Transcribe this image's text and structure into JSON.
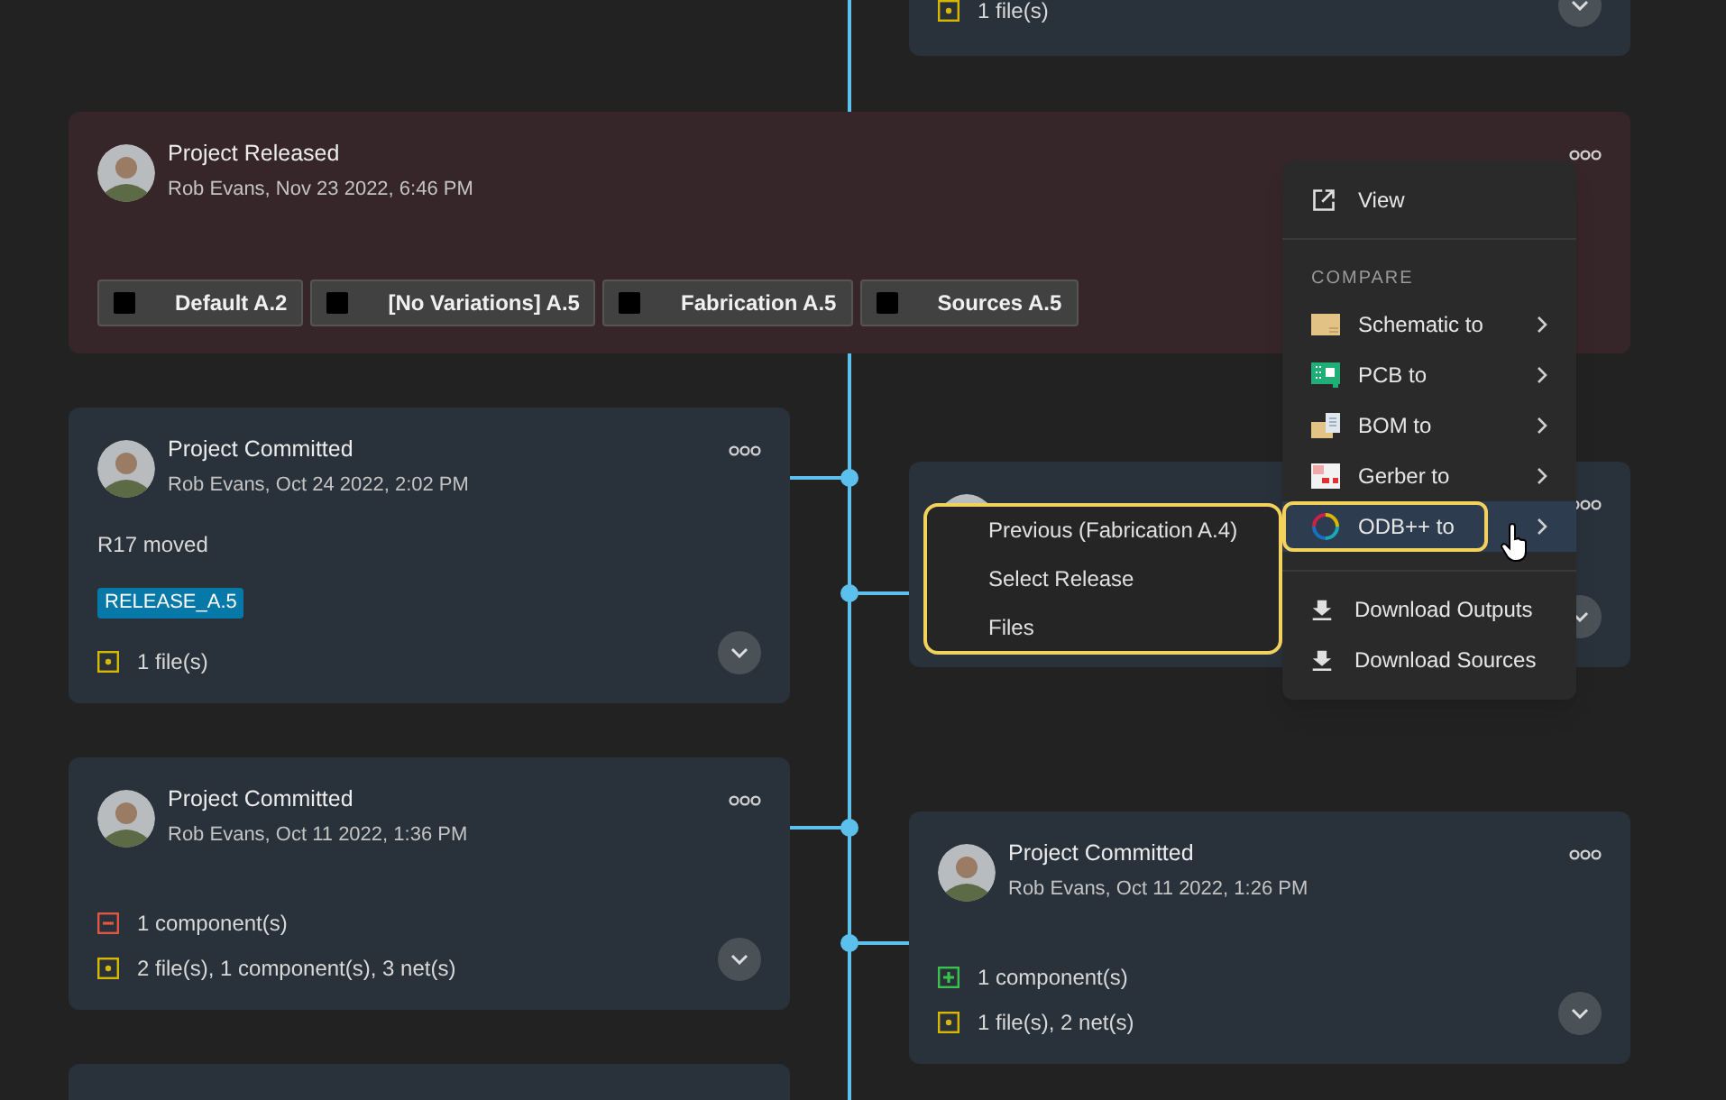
{
  "timeline": [
    {
      "kind": "commit",
      "changes": [
        {
          "kind": "modified",
          "text": "1 file(s)"
        }
      ]
    },
    {
      "kind": "release",
      "title": "Project Released",
      "byline": "Rob Evans, Nov 23 2022, 6:46 PM",
      "variants": [
        "Default A.2",
        "[No Variations] A.5",
        "Fabrication A.5",
        "Sources A.5"
      ]
    },
    {
      "kind": "commit",
      "title": "Project Committed",
      "byline": "Rob Evans, Oct 24 2022, 2:02 PM",
      "note": "R17 moved",
      "tags": [
        "RELEASE_A.5"
      ],
      "changes": [
        {
          "kind": "modified",
          "text": "1 file(s)"
        }
      ]
    },
    {
      "kind": "commit"
    },
    {
      "kind": "commit",
      "title": "Project Committed",
      "byline": "Rob Evans, Oct 11 2022, 1:36 PM",
      "changes": [
        {
          "kind": "removed",
          "text": "1 component(s)"
        },
        {
          "kind": "modified",
          "text": "2 file(s), 1 component(s), 3 net(s)"
        }
      ]
    },
    {
      "kind": "commit",
      "title": "Project Committed",
      "byline": "Rob Evans, Oct 11 2022, 1:26 PM",
      "changes": [
        {
          "kind": "added",
          "text": "1 component(s)"
        },
        {
          "kind": "modified",
          "text": "1 file(s), 2 net(s)"
        }
      ]
    },
    {
      "kind": "stub"
    }
  ],
  "menu": {
    "items": [
      {
        "kind": "action",
        "label": "View"
      },
      {
        "kind": "section",
        "label": "COMPARE"
      },
      {
        "kind": "submenu",
        "label": "Schematic to",
        "selected": false
      },
      {
        "kind": "submenu",
        "label": "PCB to",
        "selected": false
      },
      {
        "kind": "submenu",
        "label": "BOM to",
        "selected": false
      },
      {
        "kind": "submenu",
        "label": "Gerber to",
        "selected": false
      },
      {
        "kind": "submenu",
        "label": "ODB++ to",
        "selected": true
      },
      {
        "kind": "download",
        "label": "Download Outputs"
      },
      {
        "kind": "download",
        "label": "Download Sources"
      }
    ]
  },
  "submenu": {
    "items": [
      "Previous (Fabrication A.4)",
      "Select Release",
      "Files"
    ]
  }
}
